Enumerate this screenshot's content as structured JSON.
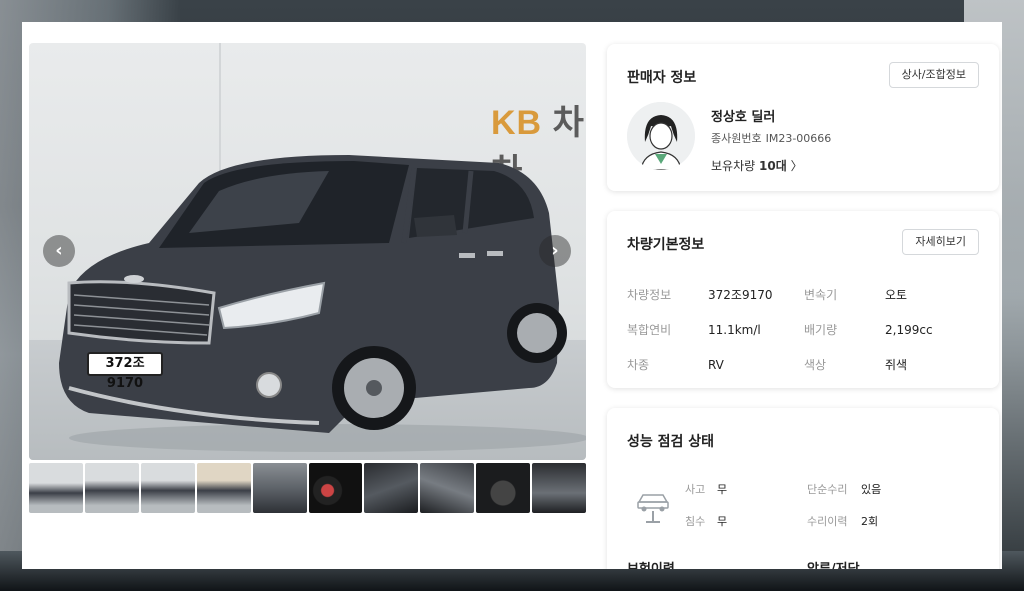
{
  "seller": {
    "title": "판매자 정보",
    "button": "상사/조합정보",
    "name": "정상호 딜러",
    "id_label": "종사원번호",
    "id_value": "IM23-00666",
    "cars_label": "보유차량",
    "cars_count": "10대",
    "cars_chevron": "〉"
  },
  "basic_info": {
    "title": "차량기본정보",
    "button": "자세히보기",
    "rows": [
      {
        "l1": "차량정보",
        "v1": "372조9170",
        "l2": "변속기",
        "v2": "오토"
      },
      {
        "l1": "복합연비",
        "v1": "11.1km/l",
        "l2": "배기량",
        "v2": "2,199cc"
      },
      {
        "l1": "차종",
        "v1": "RV",
        "l2": "색상",
        "v2": "쥐색"
      }
    ]
  },
  "performance": {
    "title": "성능 점검 상태",
    "accident_label": "사고",
    "accident_value": "무",
    "simple_repair_label": "단순수리",
    "simple_repair_value": "있음",
    "flood_label": "침수",
    "flood_value": "무",
    "repair_history_label": "수리이력",
    "repair_history_value": "2회",
    "insurance_title": "보험이력",
    "seizure_title": "압류/저당"
  },
  "photo": {
    "brand_text": "KB",
    "brand_text2": "차차",
    "plate": "372조 9170",
    "prev": "‹",
    "next": "›"
  },
  "colors": {
    "car_body": "#3b3f47",
    "brand_orange": "#d99a3c"
  }
}
